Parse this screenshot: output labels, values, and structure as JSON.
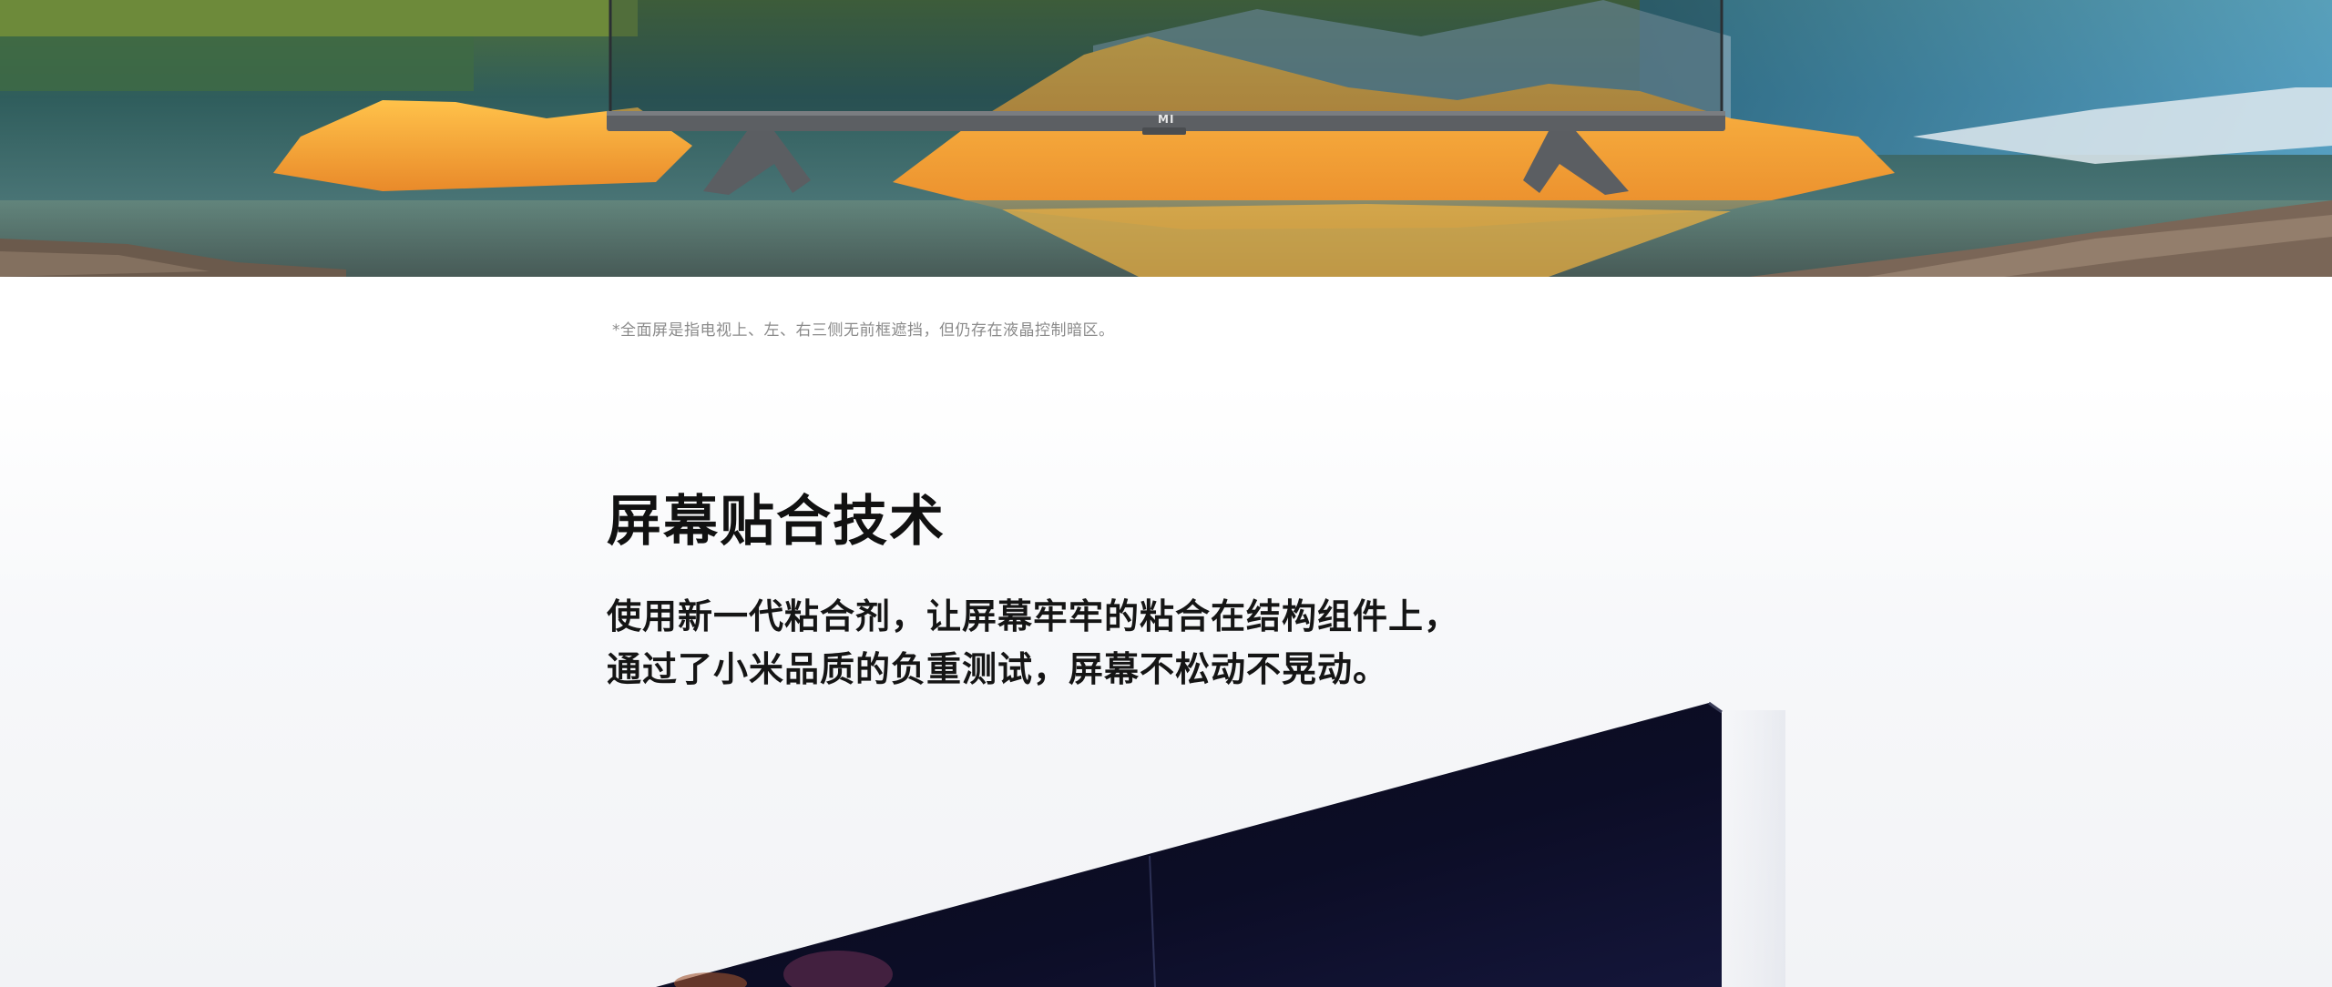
{
  "hero": {
    "brand_logo": "MI",
    "icon": "tv-icon"
  },
  "footnote": "*全面屏是指电视上、左、右三侧无前框遮挡，但仍存在液晶控制暗区。",
  "feature": {
    "title": "屏幕贴合技术",
    "description_lines": [
      "使用新一代粘合剂，让屏幕牢牢的粘合在结构组件上，",
      "通过了小米品质的负重测试，屏幕不松动不晃动。"
    ]
  },
  "colors": {
    "title": "#111111",
    "footnote": "#8a8a8a",
    "tv_frame": "#5c5f63",
    "panel": "#0b0b22"
  }
}
